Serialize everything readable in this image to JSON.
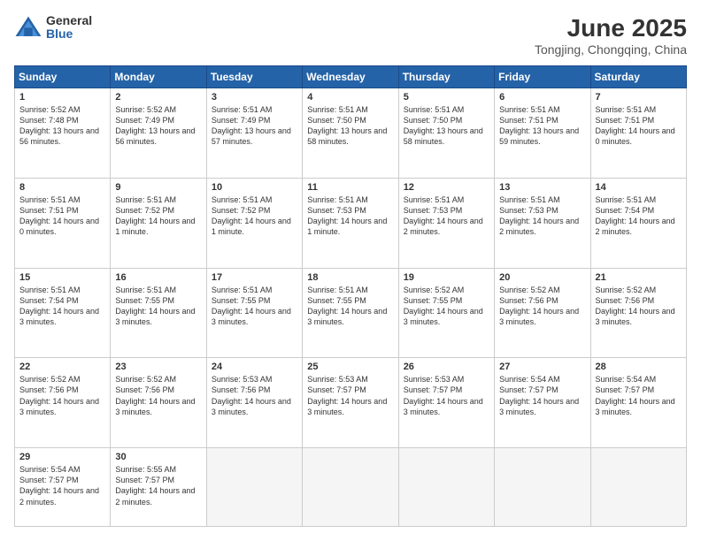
{
  "header": {
    "logo_general": "General",
    "logo_blue": "Blue",
    "main_title": "June 2025",
    "subtitle": "Tongjing, Chongqing, China"
  },
  "weekdays": [
    "Sunday",
    "Monday",
    "Tuesday",
    "Wednesday",
    "Thursday",
    "Friday",
    "Saturday"
  ],
  "weeks": [
    [
      {
        "day": "1",
        "sunrise": "5:52 AM",
        "sunset": "7:48 PM",
        "daylight": "13 hours and 56 minutes."
      },
      {
        "day": "2",
        "sunrise": "5:52 AM",
        "sunset": "7:49 PM",
        "daylight": "13 hours and 56 minutes."
      },
      {
        "day": "3",
        "sunrise": "5:51 AM",
        "sunset": "7:49 PM",
        "daylight": "13 hours and 57 minutes."
      },
      {
        "day": "4",
        "sunrise": "5:51 AM",
        "sunset": "7:50 PM",
        "daylight": "13 hours and 58 minutes."
      },
      {
        "day": "5",
        "sunrise": "5:51 AM",
        "sunset": "7:50 PM",
        "daylight": "13 hours and 58 minutes."
      },
      {
        "day": "6",
        "sunrise": "5:51 AM",
        "sunset": "7:51 PM",
        "daylight": "13 hours and 59 minutes."
      },
      {
        "day": "7",
        "sunrise": "5:51 AM",
        "sunset": "7:51 PM",
        "daylight": "14 hours and 0 minutes."
      }
    ],
    [
      {
        "day": "8",
        "sunrise": "5:51 AM",
        "sunset": "7:51 PM",
        "daylight": "14 hours and 0 minutes."
      },
      {
        "day": "9",
        "sunrise": "5:51 AM",
        "sunset": "7:52 PM",
        "daylight": "14 hours and 1 minute."
      },
      {
        "day": "10",
        "sunrise": "5:51 AM",
        "sunset": "7:52 PM",
        "daylight": "14 hours and 1 minute."
      },
      {
        "day": "11",
        "sunrise": "5:51 AM",
        "sunset": "7:53 PM",
        "daylight": "14 hours and 1 minute."
      },
      {
        "day": "12",
        "sunrise": "5:51 AM",
        "sunset": "7:53 PM",
        "daylight": "14 hours and 2 minutes."
      },
      {
        "day": "13",
        "sunrise": "5:51 AM",
        "sunset": "7:53 PM",
        "daylight": "14 hours and 2 minutes."
      },
      {
        "day": "14",
        "sunrise": "5:51 AM",
        "sunset": "7:54 PM",
        "daylight": "14 hours and 2 minutes."
      }
    ],
    [
      {
        "day": "15",
        "sunrise": "5:51 AM",
        "sunset": "7:54 PM",
        "daylight": "14 hours and 3 minutes."
      },
      {
        "day": "16",
        "sunrise": "5:51 AM",
        "sunset": "7:55 PM",
        "daylight": "14 hours and 3 minutes."
      },
      {
        "day": "17",
        "sunrise": "5:51 AM",
        "sunset": "7:55 PM",
        "daylight": "14 hours and 3 minutes."
      },
      {
        "day": "18",
        "sunrise": "5:51 AM",
        "sunset": "7:55 PM",
        "daylight": "14 hours and 3 minutes."
      },
      {
        "day": "19",
        "sunrise": "5:52 AM",
        "sunset": "7:55 PM",
        "daylight": "14 hours and 3 minutes."
      },
      {
        "day": "20",
        "sunrise": "5:52 AM",
        "sunset": "7:56 PM",
        "daylight": "14 hours and 3 minutes."
      },
      {
        "day": "21",
        "sunrise": "5:52 AM",
        "sunset": "7:56 PM",
        "daylight": "14 hours and 3 minutes."
      }
    ],
    [
      {
        "day": "22",
        "sunrise": "5:52 AM",
        "sunset": "7:56 PM",
        "daylight": "14 hours and 3 minutes."
      },
      {
        "day": "23",
        "sunrise": "5:52 AM",
        "sunset": "7:56 PM",
        "daylight": "14 hours and 3 minutes."
      },
      {
        "day": "24",
        "sunrise": "5:53 AM",
        "sunset": "7:56 PM",
        "daylight": "14 hours and 3 minutes."
      },
      {
        "day": "25",
        "sunrise": "5:53 AM",
        "sunset": "7:57 PM",
        "daylight": "14 hours and 3 minutes."
      },
      {
        "day": "26",
        "sunrise": "5:53 AM",
        "sunset": "7:57 PM",
        "daylight": "14 hours and 3 minutes."
      },
      {
        "day": "27",
        "sunrise": "5:54 AM",
        "sunset": "7:57 PM",
        "daylight": "14 hours and 3 minutes."
      },
      {
        "day": "28",
        "sunrise": "5:54 AM",
        "sunset": "7:57 PM",
        "daylight": "14 hours and 3 minutes."
      }
    ],
    [
      {
        "day": "29",
        "sunrise": "5:54 AM",
        "sunset": "7:57 PM",
        "daylight": "14 hours and 2 minutes."
      },
      {
        "day": "30",
        "sunrise": "5:55 AM",
        "sunset": "7:57 PM",
        "daylight": "14 hours and 2 minutes."
      },
      null,
      null,
      null,
      null,
      null
    ]
  ]
}
